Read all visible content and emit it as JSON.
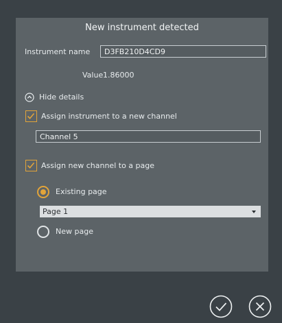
{
  "dialog": {
    "title": "New instrument detected",
    "instrument_name_label": "Instrument name",
    "instrument_name_value": "D3FB210D4CD9",
    "value_label": "Value",
    "value": "1.86000",
    "details_toggle_label": "Hide details",
    "assign_channel_label": "Assign instrument to a new channel",
    "assign_channel_checked": true,
    "channel_name_value": "Channel 5",
    "assign_page_label": "Assign new channel to a page",
    "assign_page_checked": true,
    "existing_page_label": "Existing page",
    "existing_page_selected": true,
    "page_select_value": "Page 1",
    "new_page_label": "New page",
    "new_page_selected": false
  },
  "footer": {
    "confirm_icon": "check-circle-icon",
    "cancel_icon": "close-circle-icon"
  },
  "colors": {
    "background": "#3a4146",
    "panel": "#5c6367",
    "accent": "#e2a43a"
  }
}
